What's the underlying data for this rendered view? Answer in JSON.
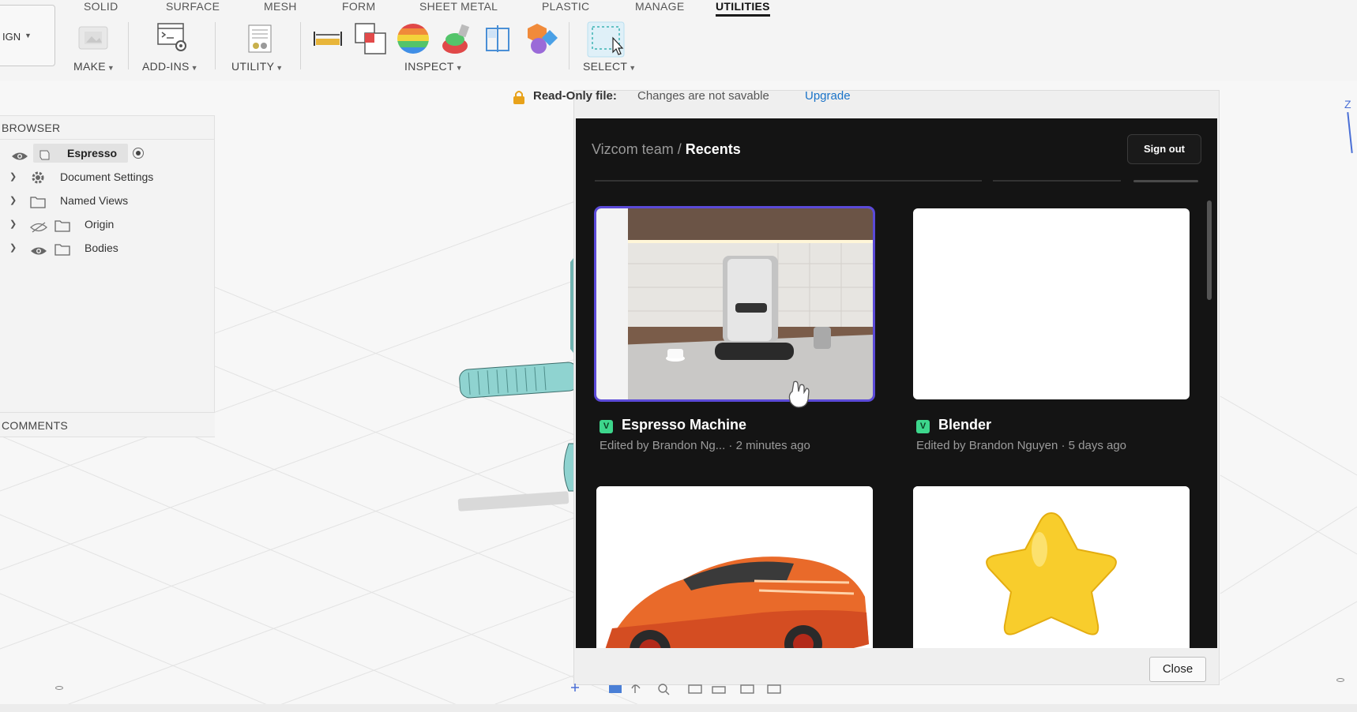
{
  "toolbar": {
    "tabs": [
      "SOLID",
      "SURFACE",
      "MESH",
      "FORM",
      "SHEET METAL",
      "PLASTIC",
      "MANAGE",
      "UTILITIES"
    ],
    "active_tab": "UTILITIES",
    "design_label": "IGN",
    "groups": {
      "make": "MAKE",
      "addins": "ADD-INS",
      "utility": "UTILITY",
      "inspect": "INSPECT",
      "select": "SELECT"
    }
  },
  "browser": {
    "header": "BROWSER",
    "root": "Espresso",
    "items": [
      {
        "label": "Document Settings",
        "icon": "gear-icon"
      },
      {
        "label": "Named Views",
        "icon": "folder-icon"
      },
      {
        "label": "Origin",
        "icon": "folder-icon"
      },
      {
        "label": "Bodies",
        "icon": "folder-icon"
      }
    ],
    "comments": "COMMENTS"
  },
  "notice": {
    "label": "Read-Only file:",
    "message": "Changes are not savable",
    "link": "Upgrade"
  },
  "vizcom": {
    "team": "Vizcom team",
    "separator": "/",
    "section": "Recents",
    "sign_out": "Sign out",
    "badge": "V",
    "cards": [
      {
        "title": "Espresso Machine",
        "meta": "Edited by Brandon Ng... · 2 minutes ago",
        "thumb": "espresso-machine-image",
        "selected": true
      },
      {
        "title": "Blender",
        "meta": "Edited by Brandon Nguyen · 5 days ago",
        "thumb": "blank-image",
        "selected": false
      },
      {
        "title": "",
        "meta": "",
        "thumb": "orange-car-sketch-image",
        "selected": false
      },
      {
        "title": "",
        "meta": "",
        "thumb": "yellow-star-image",
        "selected": false
      }
    ]
  },
  "dialog": {
    "close": "Close"
  },
  "viewcube_axis": "Z",
  "colors": {
    "accent_blue": "#1a73c8",
    "selection_purple": "#5b4ad8",
    "vizcom_bg": "#141414",
    "badge_green": "#3dd68c",
    "model_teal": "#8fd3d0"
  }
}
